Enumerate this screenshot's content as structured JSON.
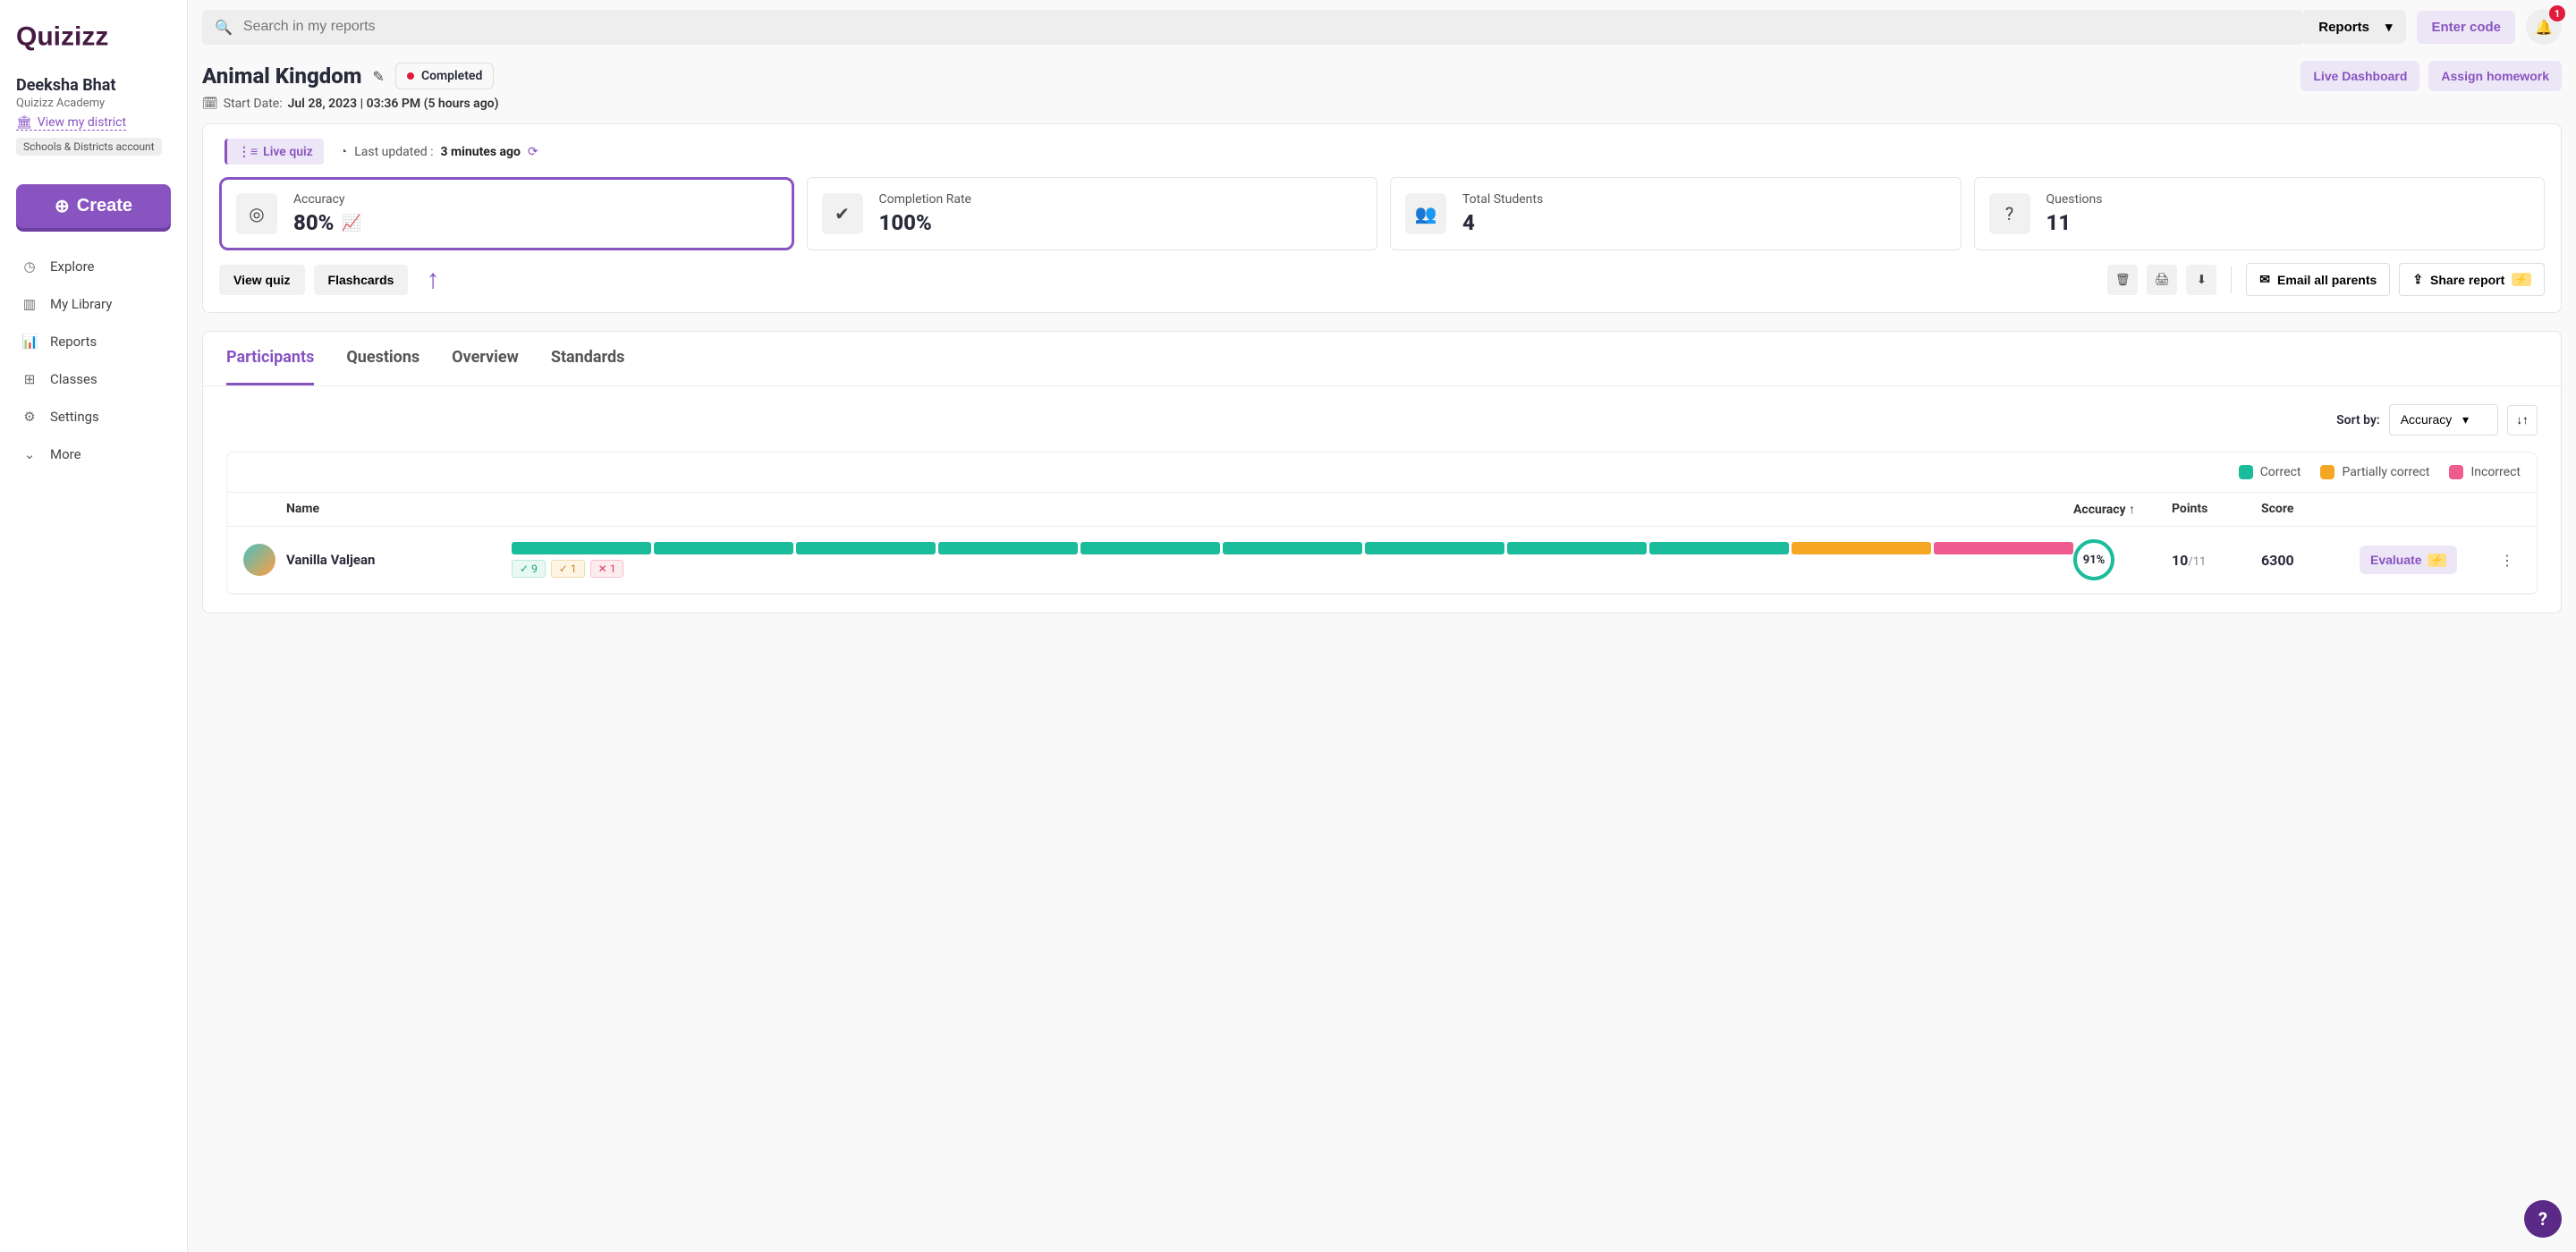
{
  "colors": {
    "brand": "#8854c0",
    "brand_light": "#ede6f6",
    "correct": "#1abc9c",
    "partial": "#f5a623",
    "incorrect": "#ef5b8f",
    "danger": "#e21b3c"
  },
  "topbar": {
    "search_placeholder": "Search in my reports",
    "dropdown_label": "Reports",
    "enter_code": "Enter code",
    "notification_count": "1"
  },
  "user": {
    "name": "Deeksha Bhat",
    "subtitle": "Quizizz Academy",
    "district_link": "View my district",
    "account_badge": "Schools & Districts account"
  },
  "sidebar": {
    "create": "Create",
    "items": [
      {
        "icon": "compass",
        "label": "Explore"
      },
      {
        "icon": "library",
        "label": "My Library"
      },
      {
        "icon": "chart",
        "label": "Reports"
      },
      {
        "icon": "grid",
        "label": "Classes"
      },
      {
        "icon": "gear",
        "label": "Settings"
      },
      {
        "icon": "chevron",
        "label": "More"
      }
    ]
  },
  "header": {
    "title": "Animal Kingdom",
    "status": "Completed",
    "live_dashboard": "Live Dashboard",
    "assign_homework": "Assign homework"
  },
  "meta": {
    "start_date_label": "Start Date:",
    "start_date_value": "Jul 28, 2023 | 03:36 PM (5 hours ago)"
  },
  "panel": {
    "live_quiz": "Live quiz",
    "last_updated_label": "Last updated :",
    "last_updated_value": "3 minutes ago",
    "stats": {
      "accuracy": {
        "label": "Accuracy",
        "value": "80%"
      },
      "completion": {
        "label": "Completion Rate",
        "value": "100%"
      },
      "students": {
        "label": "Total Students",
        "value": "4"
      },
      "questions": {
        "label": "Questions",
        "value": "11"
      }
    },
    "view_quiz": "View quiz",
    "flashcards": "Flashcards",
    "email_parents": "Email all parents",
    "share_report": "Share report"
  },
  "tabs": {
    "participants": "Participants",
    "questions": "Questions",
    "overview": "Overview",
    "standards": "Standards"
  },
  "sort": {
    "label": "Sort by:",
    "value": "Accuracy"
  },
  "legend": {
    "correct": "Correct",
    "partial": "Partially correct",
    "incorrect": "Incorrect"
  },
  "table": {
    "headers": {
      "name": "Name",
      "accuracy": "Accuracy ↑",
      "points": "Points",
      "score": "Score"
    },
    "rows": [
      {
        "name": "Vanilla Valjean",
        "bars": [
          "g",
          "g",
          "g",
          "g",
          "g",
          "g",
          "g",
          "g",
          "g",
          "o",
          "r"
        ],
        "counts": {
          "correct": "9",
          "partial": "1",
          "incorrect": "1"
        },
        "accuracy": "91%",
        "points_num": "10",
        "points_denom": "/11",
        "score": "6300",
        "evaluate": "Evaluate"
      }
    ]
  }
}
